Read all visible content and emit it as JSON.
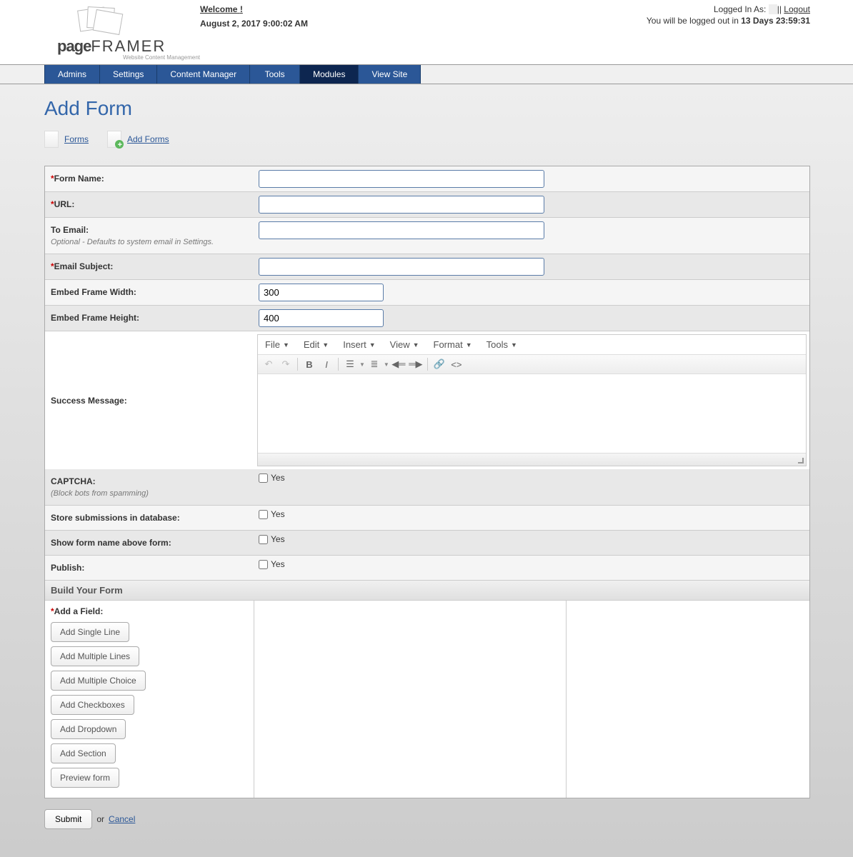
{
  "header": {
    "welcome": "Welcome",
    "welcome_user_redacted": "",
    "welcome_tail": "!",
    "date": "August 2, 2017 9:00:02 AM",
    "logged_in_as": "Logged In As:",
    "user_redacted": "",
    "sep": "||",
    "logout": "Logout",
    "countdown_pre": "You will be logged out in",
    "countdown": "13 Days 23:59:31",
    "logo_main": "page",
    "logo_framer": "FRAMER",
    "logo_sub": "Website Content Management"
  },
  "nav": {
    "items": [
      "Admins",
      "Settings",
      "Content Manager",
      "Tools",
      "Modules",
      "View Site"
    ],
    "active_index": 4
  },
  "page": {
    "title": "Add Form",
    "breadcrumb": {
      "forms": "Forms",
      "add_forms": "Add Forms"
    }
  },
  "form": {
    "rows": {
      "form_name": {
        "label": "Form Name:",
        "required": true,
        "value": ""
      },
      "url": {
        "label": "URL:",
        "required": true,
        "value": ""
      },
      "to_email": {
        "label": "To Email:",
        "required": false,
        "hint": "Optional - Defaults to system email in Settings.",
        "value": ""
      },
      "email_subject": {
        "label": "Email Subject:",
        "required": true,
        "value": ""
      },
      "frame_width": {
        "label": "Embed Frame Width:",
        "required": false,
        "value": "300"
      },
      "frame_height": {
        "label": "Embed Frame Height:",
        "required": false,
        "value": "400"
      },
      "success_msg": {
        "label": "Success Message:"
      },
      "captcha": {
        "label": "CAPTCHA:",
        "hint": "(Block bots from spamming)",
        "option": "Yes",
        "checked": false
      },
      "store_db": {
        "label": "Store submissions in database:",
        "option": "Yes",
        "checked": false
      },
      "show_name": {
        "label": "Show form name above form:",
        "option": "Yes",
        "checked": false
      },
      "publish": {
        "label": "Publish:",
        "option": "Yes",
        "checked": false
      }
    },
    "editor": {
      "menus": [
        "File",
        "Edit",
        "Insert",
        "View",
        "Format",
        "Tools"
      ]
    },
    "build": {
      "title": "Build Your Form",
      "add_field": "Add a Field:",
      "buttons": [
        "Add Single Line",
        "Add Multiple Lines",
        "Add Multiple Choice",
        "Add Checkboxes",
        "Add Dropdown",
        "Add Section",
        "Preview form"
      ]
    }
  },
  "footer": {
    "submit": "Submit",
    "or": "or",
    "cancel": "Cancel"
  }
}
